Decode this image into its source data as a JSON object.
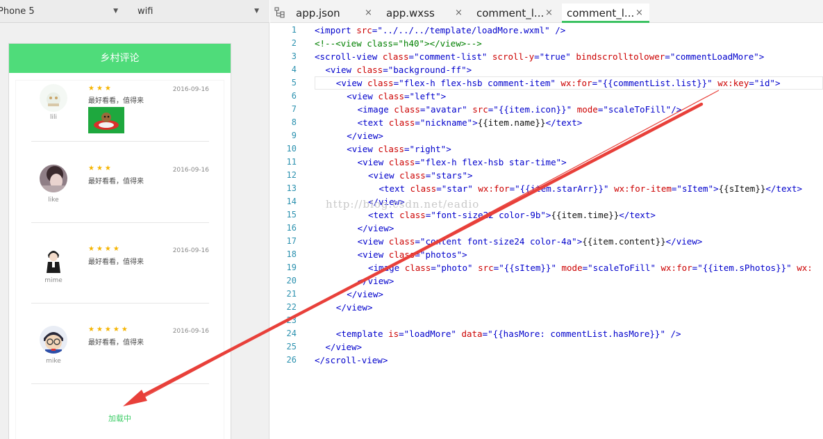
{
  "simulator": {
    "device": "Phone 5",
    "network": "wifi",
    "nav_title": "乡村评论",
    "load_more": "加载中",
    "comments": [
      {
        "name": "lili",
        "stars": "★★★",
        "time": "2016-09-16",
        "text": "最好看看，值得来",
        "has_photo": true
      },
      {
        "name": "like",
        "stars": "★★★",
        "time": "2016-09-16",
        "text": "最好看看，值得来",
        "has_photo": false
      },
      {
        "name": "mime",
        "stars": "★★★★",
        "time": "2016-09-16",
        "text": "最好看看，值得来",
        "has_photo": false
      },
      {
        "name": "mike",
        "stars": "★★★★★",
        "time": "2016-09-16",
        "text": "最好看看，值得来",
        "has_photo": false
      }
    ]
  },
  "editor": {
    "tabs": [
      {
        "label": "app.json",
        "close": "×"
      },
      {
        "label": "app.wxss",
        "close": "×"
      },
      {
        "label": "comment_l...",
        "close": "×"
      },
      {
        "label": "comment_l...",
        "close": "×"
      }
    ],
    "active_tab": 3,
    "watermark": "http://blog.csdn.net/eadio",
    "lines": [
      {
        "n": "1",
        "indent": 0,
        "tokens": [
          [
            "tag",
            "<import "
          ],
          [
            "attr",
            "src"
          ],
          [
            "eq",
            "="
          ],
          [
            "str",
            "\"../../../template/loadMore.wxml\""
          ],
          [
            "tag",
            " />"
          ]
        ]
      },
      {
        "n": "2",
        "indent": 0,
        "tokens": [
          [
            "cmt",
            "<!--<view class=\"h40\"></view>-->"
          ]
        ]
      },
      {
        "n": "3",
        "indent": 0,
        "tokens": [
          [
            "tag",
            "<scroll-view "
          ],
          [
            "attr",
            "class"
          ],
          [
            "eq",
            "="
          ],
          [
            "str",
            "\"comment-list\" "
          ],
          [
            "attr",
            "scroll-y"
          ],
          [
            "eq",
            "="
          ],
          [
            "str",
            "\"true\" "
          ],
          [
            "attr",
            "bindscrolltolower"
          ],
          [
            "eq",
            "="
          ],
          [
            "str",
            "\"commentLoadMore\""
          ],
          [
            "tag",
            ">"
          ]
        ]
      },
      {
        "n": "4",
        "indent": 1,
        "tokens": [
          [
            "tag",
            "<view "
          ],
          [
            "attr",
            "class"
          ],
          [
            "eq",
            "="
          ],
          [
            "str",
            "\"background-ff\""
          ],
          [
            "tag",
            ">"
          ]
        ]
      },
      {
        "n": "5",
        "indent": 2,
        "tokens": [
          [
            "tag",
            "<view "
          ],
          [
            "attr",
            "class"
          ],
          [
            "eq",
            "="
          ],
          [
            "str",
            "\"flex-h flex-hsb comment-item\" "
          ],
          [
            "attr",
            "wx:for"
          ],
          [
            "eq",
            "="
          ],
          [
            "str",
            "\"{{commentList.list}}\" "
          ],
          [
            "attr",
            "wx:key"
          ],
          [
            "eq",
            "="
          ],
          [
            "str",
            "\"id\""
          ],
          [
            "tag",
            ">"
          ]
        ]
      },
      {
        "n": "6",
        "indent": 3,
        "tokens": [
          [
            "tag",
            "<view "
          ],
          [
            "attr",
            "class"
          ],
          [
            "eq",
            "="
          ],
          [
            "str",
            "\"left\""
          ],
          [
            "tag",
            ">"
          ]
        ]
      },
      {
        "n": "7",
        "indent": 4,
        "tokens": [
          [
            "tag",
            "<image "
          ],
          [
            "attr",
            "class"
          ],
          [
            "eq",
            "="
          ],
          [
            "str",
            "\"avatar\" "
          ],
          [
            "attr",
            "src"
          ],
          [
            "eq",
            "="
          ],
          [
            "str",
            "\"{{item.icon}}\" "
          ],
          [
            "attr",
            "mode"
          ],
          [
            "eq",
            "="
          ],
          [
            "str",
            "\"scaleToFill\""
          ],
          [
            "tag",
            "/>"
          ]
        ]
      },
      {
        "n": "8",
        "indent": 4,
        "tokens": [
          [
            "tag",
            "<text "
          ],
          [
            "attr",
            "class"
          ],
          [
            "eq",
            "="
          ],
          [
            "str",
            "\"nickname\""
          ],
          [
            "tag",
            ">"
          ],
          [
            "text",
            "{{item.name}}"
          ],
          [
            "tag",
            "</text>"
          ]
        ]
      },
      {
        "n": "9",
        "indent": 3,
        "tokens": [
          [
            "tag",
            "</view>"
          ]
        ]
      },
      {
        "n": "10",
        "indent": 3,
        "tokens": [
          [
            "tag",
            "<view "
          ],
          [
            "attr",
            "class"
          ],
          [
            "eq",
            "="
          ],
          [
            "str",
            "\"right\""
          ],
          [
            "tag",
            ">"
          ]
        ]
      },
      {
        "n": "11",
        "indent": 4,
        "tokens": [
          [
            "tag",
            "<view "
          ],
          [
            "attr",
            "class"
          ],
          [
            "eq",
            "="
          ],
          [
            "str",
            "\"flex-h flex-hsb star-time\""
          ],
          [
            "tag",
            ">"
          ]
        ]
      },
      {
        "n": "12",
        "indent": 5,
        "tokens": [
          [
            "tag",
            "<view "
          ],
          [
            "attr",
            "class"
          ],
          [
            "eq",
            "="
          ],
          [
            "str",
            "\"stars\""
          ],
          [
            "tag",
            ">"
          ]
        ]
      },
      {
        "n": "13",
        "indent": 6,
        "tokens": [
          [
            "tag",
            "<text "
          ],
          [
            "attr",
            "class"
          ],
          [
            "eq",
            "="
          ],
          [
            "str",
            "\"star\" "
          ],
          [
            "attr",
            "wx:for"
          ],
          [
            "eq",
            "="
          ],
          [
            "str",
            "\"{{item.starArr}}\" "
          ],
          [
            "attr",
            "wx:for-item"
          ],
          [
            "eq",
            "="
          ],
          [
            "str",
            "\"sItem\""
          ],
          [
            "tag",
            ">"
          ],
          [
            "text",
            "{{sItem}}"
          ],
          [
            "tag",
            "</text>"
          ]
        ]
      },
      {
        "n": "14",
        "indent": 5,
        "tokens": [
          [
            "tag",
            "</view>"
          ]
        ]
      },
      {
        "n": "15",
        "indent": 5,
        "tokens": [
          [
            "tag",
            "<text "
          ],
          [
            "attr",
            "class"
          ],
          [
            "eq",
            "="
          ],
          [
            "str",
            "\"font-size22 color-9b\""
          ],
          [
            "tag",
            ">"
          ],
          [
            "text",
            "{{item.time}}"
          ],
          [
            "tag",
            "</text>"
          ]
        ]
      },
      {
        "n": "16",
        "indent": 4,
        "tokens": [
          [
            "tag",
            "</view>"
          ]
        ]
      },
      {
        "n": "17",
        "indent": 4,
        "tokens": [
          [
            "tag",
            "<view "
          ],
          [
            "attr",
            "class"
          ],
          [
            "eq",
            "="
          ],
          [
            "str",
            "\"content font-size24 color-4a\""
          ],
          [
            "tag",
            ">"
          ],
          [
            "text",
            "{{item.content}}"
          ],
          [
            "tag",
            "</view>"
          ]
        ]
      },
      {
        "n": "18",
        "indent": 4,
        "tokens": [
          [
            "tag",
            "<view "
          ],
          [
            "attr",
            "class"
          ],
          [
            "eq",
            "="
          ],
          [
            "str",
            "\"photos\""
          ],
          [
            "tag",
            ">"
          ]
        ]
      },
      {
        "n": "19",
        "indent": 5,
        "tokens": [
          [
            "tag",
            "<image "
          ],
          [
            "attr",
            "class"
          ],
          [
            "eq",
            "="
          ],
          [
            "str",
            "\"photo\" "
          ],
          [
            "attr",
            "src"
          ],
          [
            "eq",
            "="
          ],
          [
            "str",
            "\"{{sItem}}\" "
          ],
          [
            "attr",
            "mode"
          ],
          [
            "eq",
            "="
          ],
          [
            "str",
            "\"scaleToFill\" "
          ],
          [
            "attr",
            "wx:for"
          ],
          [
            "eq",
            "="
          ],
          [
            "str",
            "\"{{item.sPhotos}}\" "
          ],
          [
            "attr",
            "wx:"
          ]
        ]
      },
      {
        "n": "20",
        "indent": 4,
        "tokens": [
          [
            "tag",
            "</view>"
          ]
        ]
      },
      {
        "n": "21",
        "indent": 3,
        "tokens": [
          [
            "tag",
            "</view>"
          ]
        ]
      },
      {
        "n": "22",
        "indent": 2,
        "tokens": [
          [
            "tag",
            "</view>"
          ]
        ]
      },
      {
        "n": "23",
        "indent": 0,
        "tokens": []
      },
      {
        "n": "24",
        "indent": 2,
        "tokens": [
          [
            "tag",
            "<template "
          ],
          [
            "attr",
            "is"
          ],
          [
            "eq",
            "="
          ],
          [
            "str",
            "\"loadMore\" "
          ],
          [
            "attr",
            "data"
          ],
          [
            "eq",
            "="
          ],
          [
            "str",
            "\"{{hasMore: commentList.hasMore}}\""
          ],
          [
            "tag",
            " />"
          ]
        ]
      },
      {
        "n": "25",
        "indent": 1,
        "tokens": [
          [
            "tag",
            "</view>"
          ]
        ]
      },
      {
        "n": "26",
        "indent": 0,
        "tokens": [
          [
            "tag",
            "</scroll-view>"
          ]
        ]
      }
    ]
  },
  "colors": {
    "accent": "#4fdc7a",
    "arrow": "#e8403a"
  }
}
